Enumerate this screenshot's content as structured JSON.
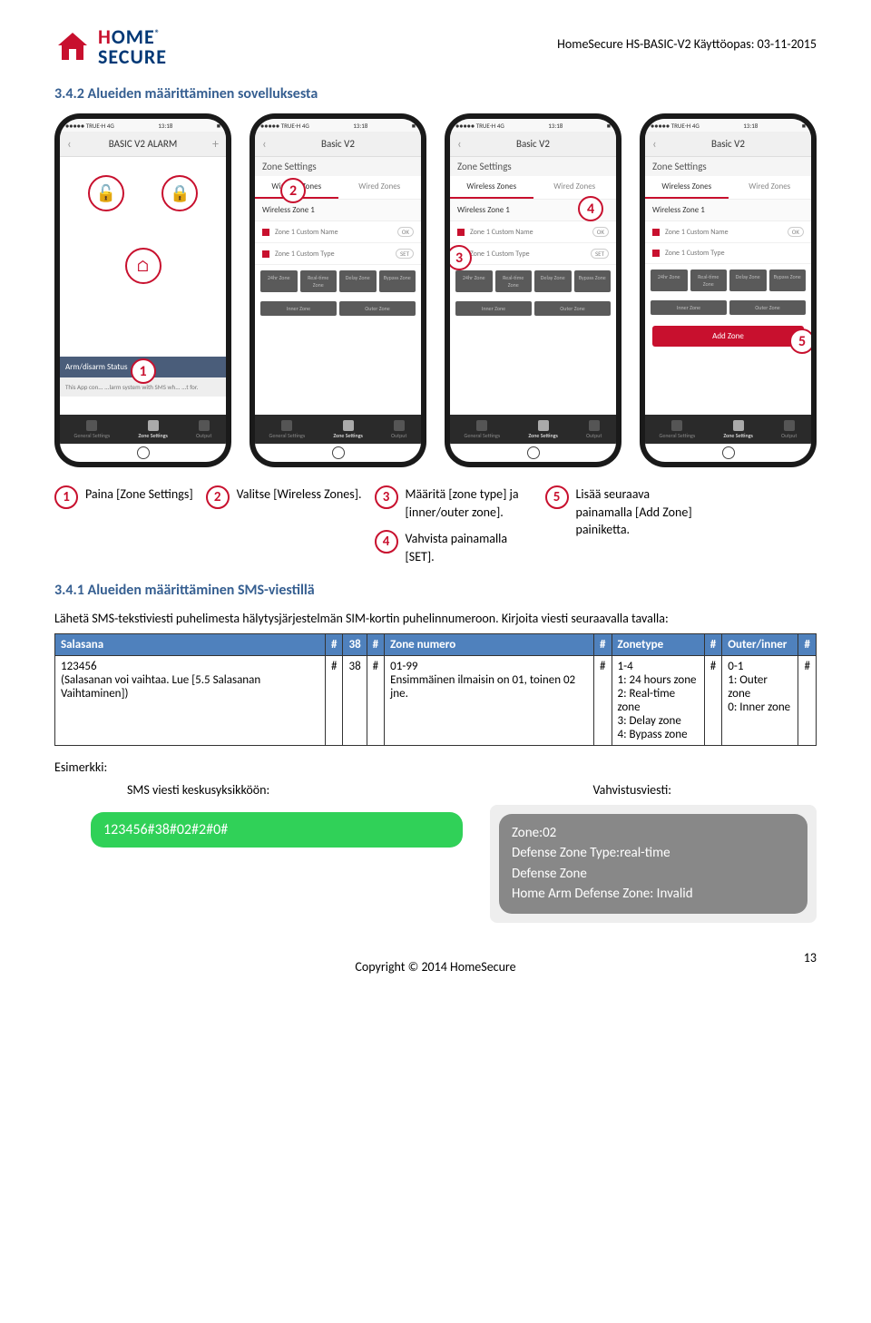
{
  "header": {
    "doc": "HomeSecure HS-BASIC-V2 Käyttöopas: 03-11-2015"
  },
  "sec1": "3.4.2 Alueiden määrittäminen sovelluksesta",
  "sec2": "3.4.1 Alueiden määrittäminen SMS-viestillä",
  "phone": {
    "status_l": "●●●●● TRUE-H 4G",
    "status_c": "13:18",
    "status_r": "■",
    "p1_title": "BASIC V2 ALARM",
    "p1_banner": "Arm/disarm Status",
    "p1_desc": "This App con... ...larm system with SMS wh... ...t for.",
    "nav_title": "Basic V2",
    "sub": "Zone Settings",
    "tab_wl": "Wireless Zones",
    "tab_wd": "Wired Zones",
    "sec_wz1": "Wireless Zone 1",
    "row_name": "Zone 1 Custom Name",
    "row_type": "Zone 1 Custom Type",
    "ok": "OK",
    "set": "SET",
    "b24": "24hr Zone",
    "brt": "Real-time Zone",
    "bdl": "Delay Zone",
    "bbp": "Bypass Zone",
    "binner": "Inner Zone",
    "bouter": "Outer Zone",
    "add": "Add Zone",
    "bot1": "General Settings",
    "bot2": "Zone Settings",
    "bot3": "Output"
  },
  "steps": {
    "s1": "Paina [Zone Settings]",
    "s2": "Valitse [Wireless Zones].",
    "s3": "Määritä [zone type] ja [inner/outer zone].",
    "s4": "Vahvista painamalla [SET].",
    "s5": "Lisää seuraava painamalla [Add Zone] painiketta."
  },
  "intro": "Lähetä SMS-tekstiviesti puhelimesta hälytysjärjestelmän SIM-kortin puhelinnumeroon. Kirjoita viesti seuraavalla tavalla:",
  "th": {
    "c1": "Salasana",
    "h": "#",
    "c2": "38",
    "c3": "Zone numero",
    "c4": "Zonetype",
    "c5": "Outer/inner"
  },
  "td": {
    "c1": "123456\n(Salasanan voi vaihtaa. Lue [5.5 Salasanan Vaihtaminen])",
    "c2": "38",
    "c3": "01-99\nEnsimmäinen ilmaisin on 01, toinen 02 jne.",
    "c4": "1-4\n1: 24 hours zone\n2: Real-time zone\n3: Delay zone\n4: Bypass zone",
    "c5": "0-1\n1: Outer zone\n0: Inner zone"
  },
  "ex": "Esimerkki:",
  "lab1": "SMS viesti keskusyksikköön:",
  "lab2": "Vahvistusviesti:",
  "sms": "123456#38#02#2#0#",
  "reply": "Zone:02\nDefense Zone Type:real-time\nDefense Zone\nHome Arm Defense Zone: Invalid",
  "footer": "Copyright © 2014 HomeSecure",
  "page": "13"
}
